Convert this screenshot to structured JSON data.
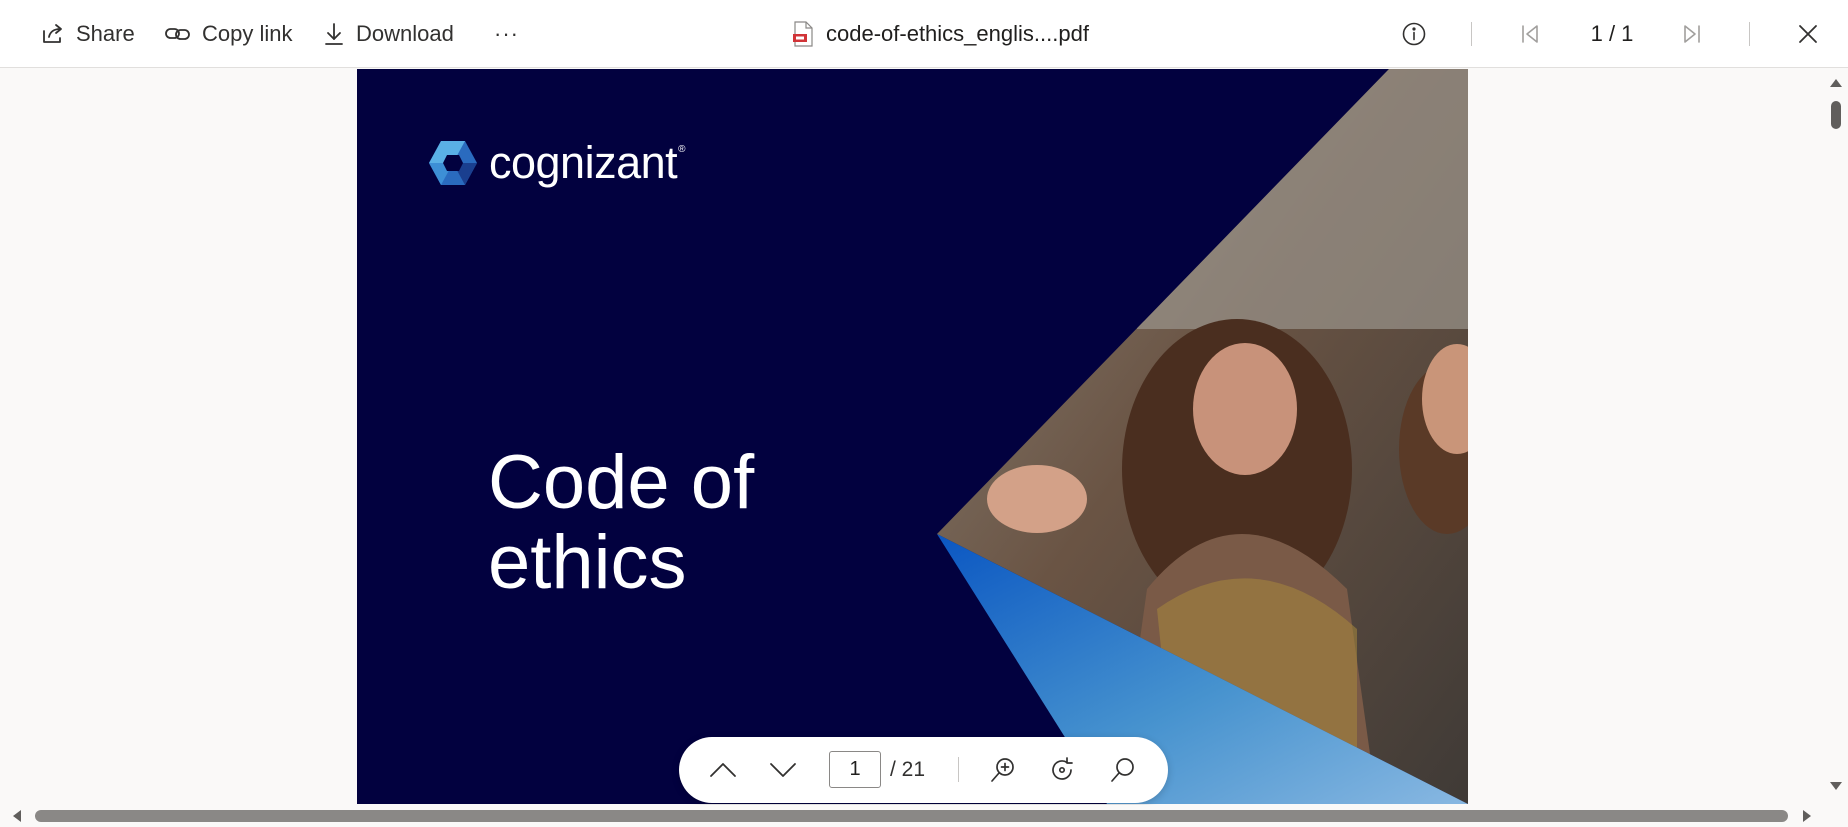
{
  "toolbar": {
    "share_label": "Share",
    "copy_link_label": "Copy link",
    "download_label": "Download",
    "more_label": "···",
    "file_name": "code-of-ethics_englis....pdf",
    "page_indicator": "1 / 1",
    "icons": {
      "share": "share-icon",
      "copy_link": "link-icon",
      "download": "download-icon",
      "file": "pdf-file-icon",
      "info": "info-icon",
      "first_page": "first-page-icon",
      "last_page": "last-page-icon",
      "close": "close-icon"
    }
  },
  "document": {
    "brand_name": "cognizant",
    "brand_mark": "®",
    "title_line1": "Code of",
    "title_line2": "ethics",
    "colors": {
      "background": "#02013f",
      "text": "#ffffff",
      "accent_blue": "#1e6fd0",
      "accent_light": "#7ab6e6"
    }
  },
  "page_nav": {
    "current_page": "1",
    "total_pages": "/ 21",
    "icons": {
      "previous": "chevron-up-icon",
      "next": "chevron-down-icon",
      "zoom_in": "zoom-in-icon",
      "rotate": "rotate-icon",
      "search": "search-icon"
    }
  }
}
